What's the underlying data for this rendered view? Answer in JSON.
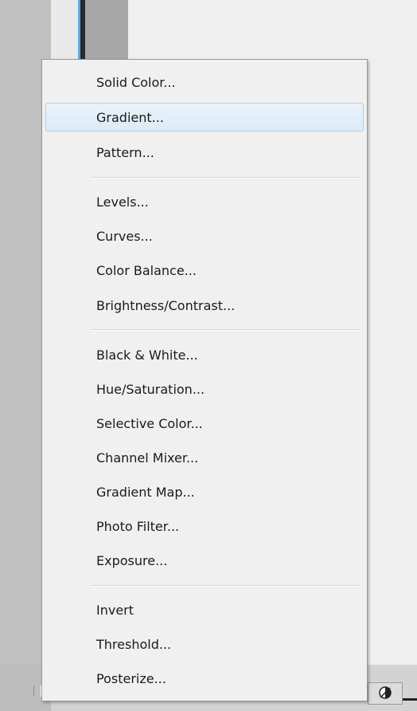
{
  "menu": {
    "groups": [
      {
        "items": [
          {
            "label": "Solid Color...",
            "highlighted": false
          },
          {
            "label": "Gradient...",
            "highlighted": true
          },
          {
            "label": "Pattern...",
            "highlighted": false
          }
        ]
      },
      {
        "items": [
          {
            "label": "Levels...",
            "highlighted": false
          },
          {
            "label": "Curves...",
            "highlighted": false
          },
          {
            "label": "Color Balance...",
            "highlighted": false
          },
          {
            "label": "Brightness/Contrast...",
            "highlighted": false
          }
        ]
      },
      {
        "items": [
          {
            "label": "Black & White...",
            "highlighted": false
          },
          {
            "label": "Hue/Saturation...",
            "highlighted": false
          },
          {
            "label": "Selective Color...",
            "highlighted": false
          },
          {
            "label": "Channel Mixer...",
            "highlighted": false
          },
          {
            "label": "Gradient Map...",
            "highlighted": false
          },
          {
            "label": "Photo Filter...",
            "highlighted": false
          },
          {
            "label": "Exposure...",
            "highlighted": false
          }
        ]
      },
      {
        "items": [
          {
            "label": "Invert",
            "highlighted": false
          },
          {
            "label": "Threshold...",
            "highlighted": false
          },
          {
            "label": "Posterize...",
            "highlighted": false
          }
        ]
      }
    ]
  },
  "toolbar": {
    "adjustment_button_icon": "adjustment-layer-icon"
  },
  "colors": {
    "menu_background": "#f0f0f0",
    "highlight_border": "#aecfe9",
    "highlight_fill": "#dcebf7",
    "accent_blue": "#5aa6e6"
  }
}
